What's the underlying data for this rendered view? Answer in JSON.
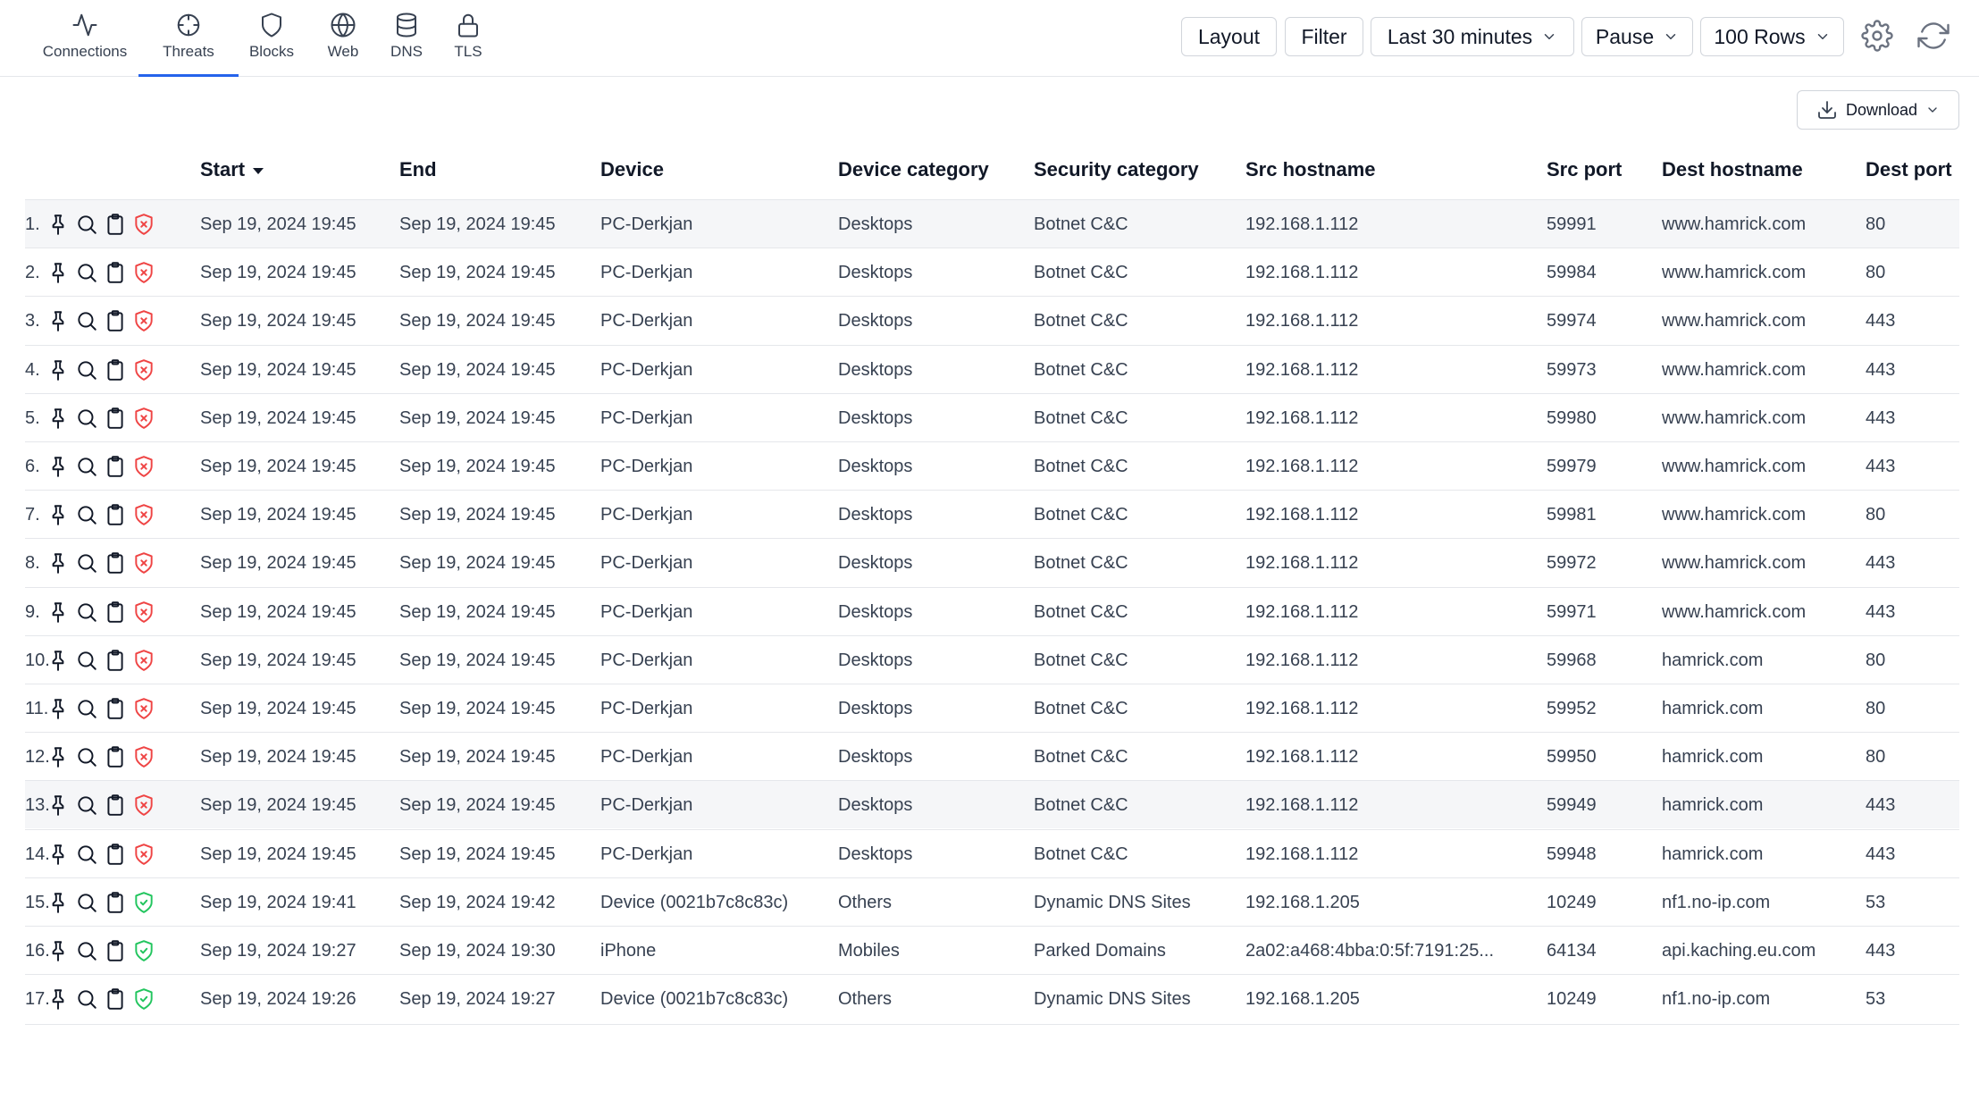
{
  "nav": {
    "tabs": [
      {
        "label": "Connections",
        "icon": "activity-icon",
        "active": false
      },
      {
        "label": "Threats",
        "icon": "crosshair-icon",
        "active": true
      },
      {
        "label": "Blocks",
        "icon": "shield-icon",
        "active": false
      },
      {
        "label": "Web",
        "icon": "globe-icon",
        "active": false
      },
      {
        "label": "DNS",
        "icon": "database-icon",
        "active": false
      },
      {
        "label": "TLS",
        "icon": "lock-icon",
        "active": false
      }
    ]
  },
  "toolbar": {
    "layout_label": "Layout",
    "filter_label": "Filter",
    "time_range": "Last 30 minutes",
    "pause_label": "Pause",
    "rows_label": "100 Rows",
    "settings_icon": "gear-icon",
    "refresh_icon": "refresh-icon"
  },
  "download_label": "Download",
  "accent_color": "#2563eb",
  "status_colors": {
    "threat": "#ef4444",
    "ok": "#22c55e"
  },
  "table": {
    "columns": [
      {
        "key": "start",
        "label": "Start",
        "sorted": "desc"
      },
      {
        "key": "end",
        "label": "End"
      },
      {
        "key": "device",
        "label": "Device"
      },
      {
        "key": "device_category",
        "label": "Device category"
      },
      {
        "key": "security_category",
        "label": "Security category"
      },
      {
        "key": "src_hostname",
        "label": "Src hostname"
      },
      {
        "key": "src_port",
        "label": "Src port"
      },
      {
        "key": "dest_hostname",
        "label": "Dest hostname"
      },
      {
        "key": "dest_port",
        "label": "Dest port"
      }
    ],
    "rows": [
      {
        "num": "1.",
        "status": "threat",
        "start": "Sep 19, 2024 19:45",
        "end": "Sep 19, 2024 19:45",
        "device": "PC-Derkjan",
        "device_category": "Desktops",
        "security_category": "Botnet C&C",
        "src_hostname": "192.168.1.112",
        "src_port": "59991",
        "dest_hostname": "www.hamrick.com",
        "dest_port": "80"
      },
      {
        "num": "2.",
        "status": "threat",
        "start": "Sep 19, 2024 19:45",
        "end": "Sep 19, 2024 19:45",
        "device": "PC-Derkjan",
        "device_category": "Desktops",
        "security_category": "Botnet C&C",
        "src_hostname": "192.168.1.112",
        "src_port": "59984",
        "dest_hostname": "www.hamrick.com",
        "dest_port": "80"
      },
      {
        "num": "3.",
        "status": "threat",
        "start": "Sep 19, 2024 19:45",
        "end": "Sep 19, 2024 19:45",
        "device": "PC-Derkjan",
        "device_category": "Desktops",
        "security_category": "Botnet C&C",
        "src_hostname": "192.168.1.112",
        "src_port": "59974",
        "dest_hostname": "www.hamrick.com",
        "dest_port": "443"
      },
      {
        "num": "4.",
        "status": "threat",
        "start": "Sep 19, 2024 19:45",
        "end": "Sep 19, 2024 19:45",
        "device": "PC-Derkjan",
        "device_category": "Desktops",
        "security_category": "Botnet C&C",
        "src_hostname": "192.168.1.112",
        "src_port": "59973",
        "dest_hostname": "www.hamrick.com",
        "dest_port": "443"
      },
      {
        "num": "5.",
        "status": "threat",
        "start": "Sep 19, 2024 19:45",
        "end": "Sep 19, 2024 19:45",
        "device": "PC-Derkjan",
        "device_category": "Desktops",
        "security_category": "Botnet C&C",
        "src_hostname": "192.168.1.112",
        "src_port": "59980",
        "dest_hostname": "www.hamrick.com",
        "dest_port": "443"
      },
      {
        "num": "6.",
        "status": "threat",
        "start": "Sep 19, 2024 19:45",
        "end": "Sep 19, 2024 19:45",
        "device": "PC-Derkjan",
        "device_category": "Desktops",
        "security_category": "Botnet C&C",
        "src_hostname": "192.168.1.112",
        "src_port": "59979",
        "dest_hostname": "www.hamrick.com",
        "dest_port": "443"
      },
      {
        "num": "7.",
        "status": "threat",
        "start": "Sep 19, 2024 19:45",
        "end": "Sep 19, 2024 19:45",
        "device": "PC-Derkjan",
        "device_category": "Desktops",
        "security_category": "Botnet C&C",
        "src_hostname": "192.168.1.112",
        "src_port": "59981",
        "dest_hostname": "www.hamrick.com",
        "dest_port": "80"
      },
      {
        "num": "8.",
        "status": "threat",
        "start": "Sep 19, 2024 19:45",
        "end": "Sep 19, 2024 19:45",
        "device": "PC-Derkjan",
        "device_category": "Desktops",
        "security_category": "Botnet C&C",
        "src_hostname": "192.168.1.112",
        "src_port": "59972",
        "dest_hostname": "www.hamrick.com",
        "dest_port": "443"
      },
      {
        "num": "9.",
        "status": "threat",
        "start": "Sep 19, 2024 19:45",
        "end": "Sep 19, 2024 19:45",
        "device": "PC-Derkjan",
        "device_category": "Desktops",
        "security_category": "Botnet C&C",
        "src_hostname": "192.168.1.112",
        "src_port": "59971",
        "dest_hostname": "www.hamrick.com",
        "dest_port": "443"
      },
      {
        "num": "10.",
        "status": "threat",
        "start": "Sep 19, 2024 19:45",
        "end": "Sep 19, 2024 19:45",
        "device": "PC-Derkjan",
        "device_category": "Desktops",
        "security_category": "Botnet C&C",
        "src_hostname": "192.168.1.112",
        "src_port": "59968",
        "dest_hostname": "hamrick.com",
        "dest_port": "80"
      },
      {
        "num": "11.",
        "status": "threat",
        "start": "Sep 19, 2024 19:45",
        "end": "Sep 19, 2024 19:45",
        "device": "PC-Derkjan",
        "device_category": "Desktops",
        "security_category": "Botnet C&C",
        "src_hostname": "192.168.1.112",
        "src_port": "59952",
        "dest_hostname": "hamrick.com",
        "dest_port": "80"
      },
      {
        "num": "12.",
        "status": "threat",
        "start": "Sep 19, 2024 19:45",
        "end": "Sep 19, 2024 19:45",
        "device": "PC-Derkjan",
        "device_category": "Desktops",
        "security_category": "Botnet C&C",
        "src_hostname": "192.168.1.112",
        "src_port": "59950",
        "dest_hostname": "hamrick.com",
        "dest_port": "80"
      },
      {
        "num": "13.",
        "status": "threat",
        "start": "Sep 19, 2024 19:45",
        "end": "Sep 19, 2024 19:45",
        "device": "PC-Derkjan",
        "device_category": "Desktops",
        "security_category": "Botnet C&C",
        "src_hostname": "192.168.1.112",
        "src_port": "59949",
        "dest_hostname": "hamrick.com",
        "dest_port": "443"
      },
      {
        "num": "14.",
        "status": "threat",
        "start": "Sep 19, 2024 19:45",
        "end": "Sep 19, 2024 19:45",
        "device": "PC-Derkjan",
        "device_category": "Desktops",
        "security_category": "Botnet C&C",
        "src_hostname": "192.168.1.112",
        "src_port": "59948",
        "dest_hostname": "hamrick.com",
        "dest_port": "443"
      },
      {
        "num": "15.",
        "status": "ok",
        "start": "Sep 19, 2024 19:41",
        "end": "Sep 19, 2024 19:42",
        "device": "Device (0021b7c8c83c)",
        "device_category": "Others",
        "security_category": "Dynamic DNS Sites",
        "src_hostname": "192.168.1.205",
        "src_port": "10249",
        "dest_hostname": "nf1.no-ip.com",
        "dest_port": "53"
      },
      {
        "num": "16.",
        "status": "ok",
        "start": "Sep 19, 2024 19:27",
        "end": "Sep 19, 2024 19:30",
        "device": "iPhone",
        "device_category": "Mobiles",
        "security_category": "Parked Domains",
        "src_hostname": "2a02:a468:4bba:0:5f:7191:25...",
        "src_port": "64134",
        "dest_hostname": "api.kaching.eu.com",
        "dest_port": "443"
      },
      {
        "num": "17.",
        "status": "ok",
        "start": "Sep 19, 2024 19:26",
        "end": "Sep 19, 2024 19:27",
        "device": "Device (0021b7c8c83c)",
        "device_category": "Others",
        "security_category": "Dynamic DNS Sites",
        "src_hostname": "192.168.1.205",
        "src_port": "10249",
        "dest_hostname": "nf1.no-ip.com",
        "dest_port": "53"
      }
    ]
  }
}
